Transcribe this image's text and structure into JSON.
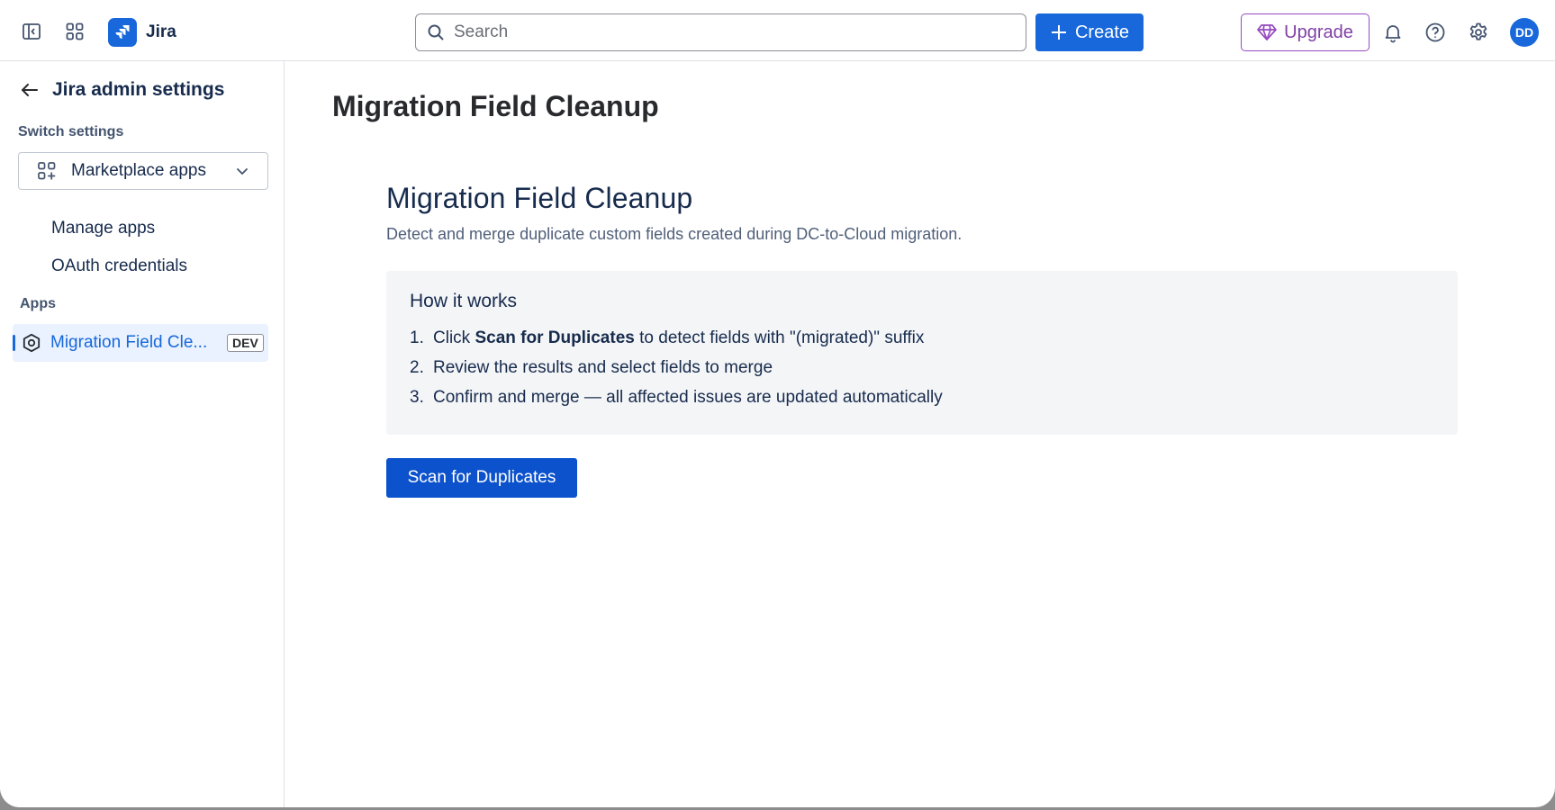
{
  "topbar": {
    "app_name": "Jira",
    "search_placeholder": "Search",
    "create_label": "Create",
    "upgrade_label": "Upgrade",
    "avatar_initials": "DD",
    "brand_color": "#1868db",
    "upgrade_color": "#803fa5"
  },
  "sidebar": {
    "back_title": "Jira admin settings",
    "switch_label": "Switch settings",
    "switch_value": "Marketplace apps",
    "items": [
      {
        "label": "Manage apps"
      },
      {
        "label": "OAuth credentials"
      }
    ],
    "apps_label": "Apps",
    "app_item": {
      "label": "Migration Field Cle...",
      "badge": "DEV"
    }
  },
  "main": {
    "page_title": "Migration Field Cleanup",
    "app_title": "Migration Field Cleanup",
    "app_description": "Detect and merge duplicate custom fields created during DC-to-Cloud migration.",
    "how_it_works": {
      "title": "How it works",
      "steps": [
        {
          "num": "1.",
          "pre": "Click ",
          "bold": "Scan for Duplicates",
          "post": " to detect fields with \"(migrated)\" suffix"
        },
        {
          "num": "2.",
          "pre": "Review the results and select fields to merge",
          "bold": "",
          "post": ""
        },
        {
          "num": "3.",
          "pre": "Confirm and merge — all affected issues are updated automatically",
          "bold": "",
          "post": ""
        }
      ]
    },
    "scan_button_label": "Scan for Duplicates"
  }
}
